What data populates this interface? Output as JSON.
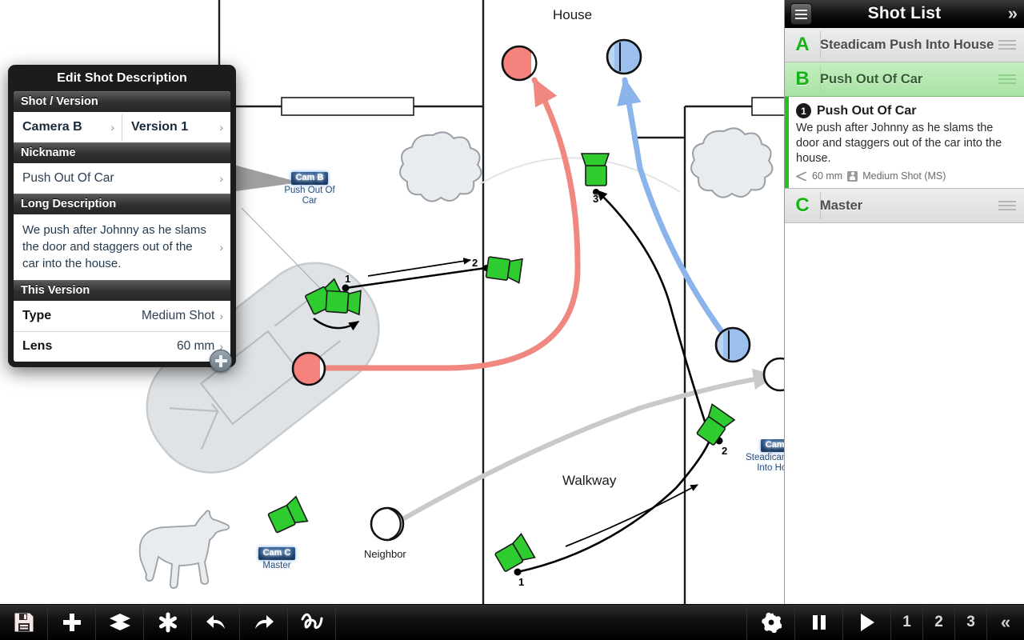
{
  "canvas": {
    "labels": {
      "house": "House",
      "walkway": "Walkway",
      "neighbor": "Neighbor"
    },
    "camera_tags": [
      {
        "badge": "Cam B",
        "sub": "Push Out Of Car"
      },
      {
        "badge": "Cam C",
        "sub": "Master"
      },
      {
        "badge": "Cam A",
        "sub": "Steadicam Push Into House"
      }
    ],
    "waypoints": {
      "cam_b": [
        "1",
        "2"
      ],
      "cam_a": [
        "1",
        "2"
      ],
      "cam_3": [
        "3"
      ]
    },
    "colors": {
      "actor_red": "#f5827c",
      "actor_blue": "#9cc0ee",
      "camera_green": "#2ecc2e",
      "path_red": "#f08880",
      "path_blue": "#8ab4ea",
      "path_gray": "#c9c9c9",
      "car_fill": "#dfe3e6",
      "tree_fill": "#e8ecef"
    }
  },
  "sidebar": {
    "header": {
      "title": "Shot List",
      "menu_icon": "hamburger-icon",
      "collapse_icon": "double-chevron-right-icon"
    },
    "shots": [
      {
        "letter": "A",
        "name": "Steadicam Push Into House",
        "selected": false
      },
      {
        "letter": "B",
        "name": "Push Out Of Car",
        "selected": true
      },
      {
        "letter": "C",
        "name": "Master",
        "selected": false
      }
    ],
    "detail": {
      "number": "1",
      "title": "Push Out Of Car",
      "description": "We push after Johnny as he slams the door and staggers out of the car into the house.",
      "lens": "60 mm",
      "shot_type": "Medium Shot (MS)"
    }
  },
  "dialog": {
    "title": "Edit Shot Description",
    "groups": {
      "shot_version_header": "Shot / Version",
      "camera": "Camera B",
      "version": "Version 1",
      "nickname_header": "Nickname",
      "nickname": "Push Out Of Car",
      "long_description_header": "Long Description",
      "long_description": "We push after Johnny as he slams the door and staggers out of the car into the house.",
      "this_version_header": "This Version",
      "type_label": "Type",
      "type_value": "Medium Shot",
      "lens_label": "Lens",
      "lens_value": "60 mm"
    },
    "chevron": "›",
    "add_button": "add-button"
  },
  "toolbar": {
    "buttons": [
      {
        "name": "save-button",
        "icon": "floppy-disk-icon"
      },
      {
        "name": "add-button",
        "icon": "plus-icon"
      },
      {
        "name": "layers-button",
        "icon": "layers-icon"
      },
      {
        "name": "effects-button",
        "icon": "asterisk-icon"
      },
      {
        "name": "undo-button",
        "icon": "undo-arrow-icon"
      },
      {
        "name": "redo-button",
        "icon": "redo-arrow-icon"
      },
      {
        "name": "scribble-button",
        "icon": "squiggle-icon"
      },
      {
        "name": "settings-button",
        "icon": "gear-icon"
      },
      {
        "name": "pause-button",
        "icon": "pause-icon"
      },
      {
        "name": "play-button",
        "icon": "play-icon"
      }
    ],
    "page_numbers": [
      "1",
      "2",
      "3"
    ],
    "collapse_icon": "double-chevron-left-icon"
  }
}
